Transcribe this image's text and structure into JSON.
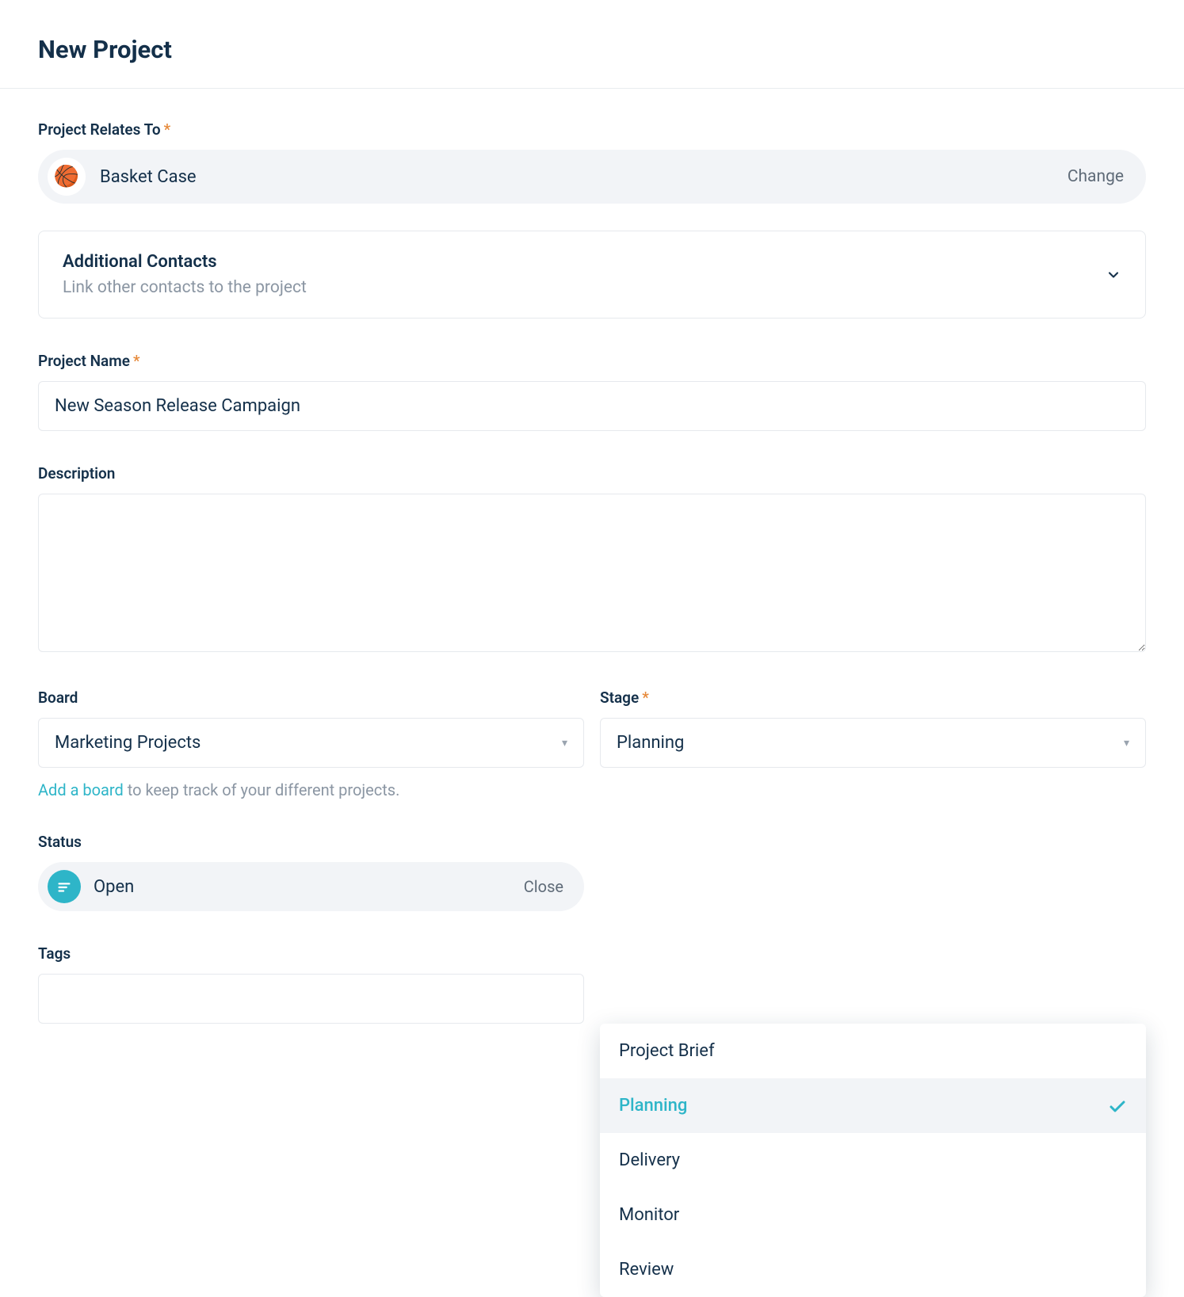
{
  "header": {
    "title": "New Project"
  },
  "relates": {
    "label": "Project Relates To",
    "avatar_emoji": "🏀",
    "name": "Basket Case",
    "change_label": "Change"
  },
  "contacts": {
    "title": "Additional Contacts",
    "subtitle": "Link other contacts to the project"
  },
  "name_field": {
    "label": "Project Name",
    "value": "New Season Release Campaign"
  },
  "description": {
    "label": "Description",
    "value": ""
  },
  "board": {
    "label": "Board",
    "value": "Marketing Projects",
    "hint_link": "Add a board",
    "hint_rest": " to keep track of your different projects."
  },
  "stage": {
    "label": "Stage",
    "value": "Planning",
    "options": [
      "Project Brief",
      "Planning",
      "Delivery",
      "Monitor",
      "Review"
    ]
  },
  "status": {
    "label": "Status",
    "value": "Open",
    "close_label": "Close"
  },
  "tags": {
    "label": "Tags"
  }
}
